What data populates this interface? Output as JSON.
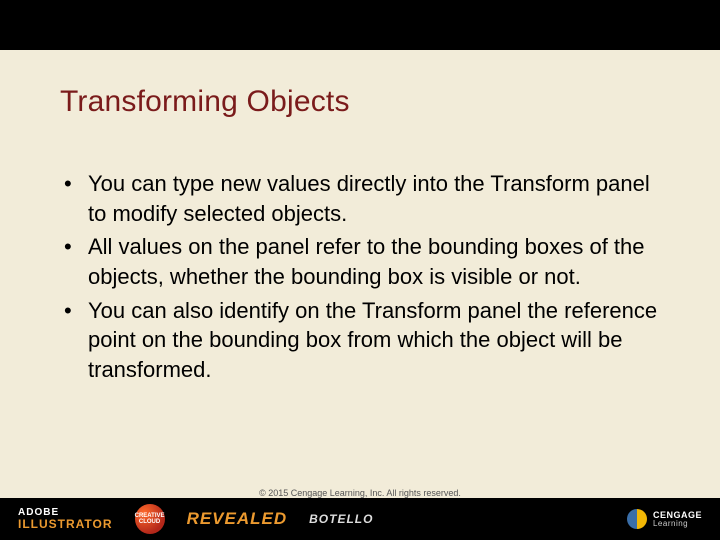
{
  "title": "Transforming Objects",
  "bullets": [
    "You can type new values directly into the Transform panel to modify selected objects.",
    "All values on the panel refer to the bounding boxes of the objects, whether the bounding box is visible or not.",
    "You can also identify on the Transform panel the reference point on the bounding box from which the object will be transformed."
  ],
  "copyright": "© 2015 Cengage Learning, Inc. All rights reserved.",
  "footer": {
    "adobe_line1": "ADOBE",
    "adobe_line2": "ILLUSTRATOR",
    "cc_line1": "CREATIVE",
    "cc_line2": "CLOUD",
    "revealed": "REVEALED",
    "author": "BOTELLO",
    "cengage_line1": "CENGAGE",
    "cengage_line2": "Learning"
  }
}
